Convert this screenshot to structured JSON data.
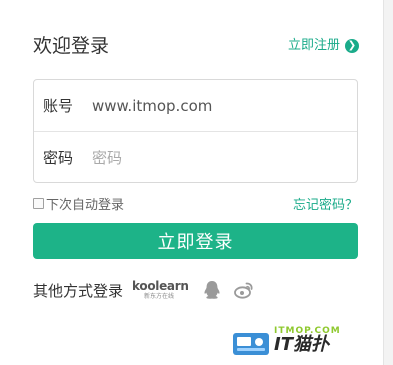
{
  "login": {
    "title": "欢迎登录",
    "register_label": "立即注册",
    "register_icon": "arrow-right-circle-icon",
    "account_label": "账号",
    "account_value": "www.itmop.com",
    "password_label": "密码",
    "password_placeholder": "密码",
    "remember_label": "下次自动登录",
    "forgot_label": "忘记密码？",
    "login_button": "立即登录",
    "other_label": "其他方式登录",
    "koolearn_logo": "koolearn",
    "koolearn_sub": "新东方在线"
  },
  "watermark": {
    "small_text": "ITMOP.COM",
    "brand_text": "IT猫扑"
  },
  "colors": {
    "accent": "#1aab8a",
    "button": "#1db388",
    "qq_icon": "#9a9a9a",
    "weibo_icon": "#9a9a9a"
  },
  "icons": [
    "arrow-right-circle-icon",
    "koolearn-logo",
    "qq-icon",
    "weibo-icon",
    "checkbox"
  ]
}
